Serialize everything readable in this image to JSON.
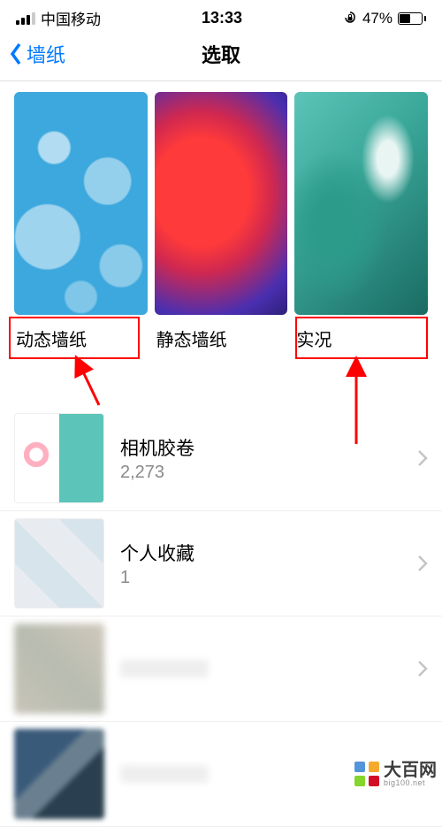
{
  "status": {
    "carrier": "中国移动",
    "time": "13:33",
    "battery_pct": "47%"
  },
  "nav": {
    "back_label": "墙纸",
    "title": "选取"
  },
  "wallpapers": [
    {
      "label": "动态墙纸"
    },
    {
      "label": "静态墙纸"
    },
    {
      "label": "实况"
    }
  ],
  "albums": [
    {
      "title": "相机胶卷",
      "count": "2,273"
    },
    {
      "title": "个人收藏",
      "count": "1"
    },
    {
      "title": "",
      "count": ""
    },
    {
      "title": "",
      "count": ""
    }
  ],
  "watermark": {
    "main": "大百网",
    "sub": "big100.net"
  },
  "annotations": {
    "highlight_color": "#ff0000",
    "arrow_color": "#ff0000"
  }
}
